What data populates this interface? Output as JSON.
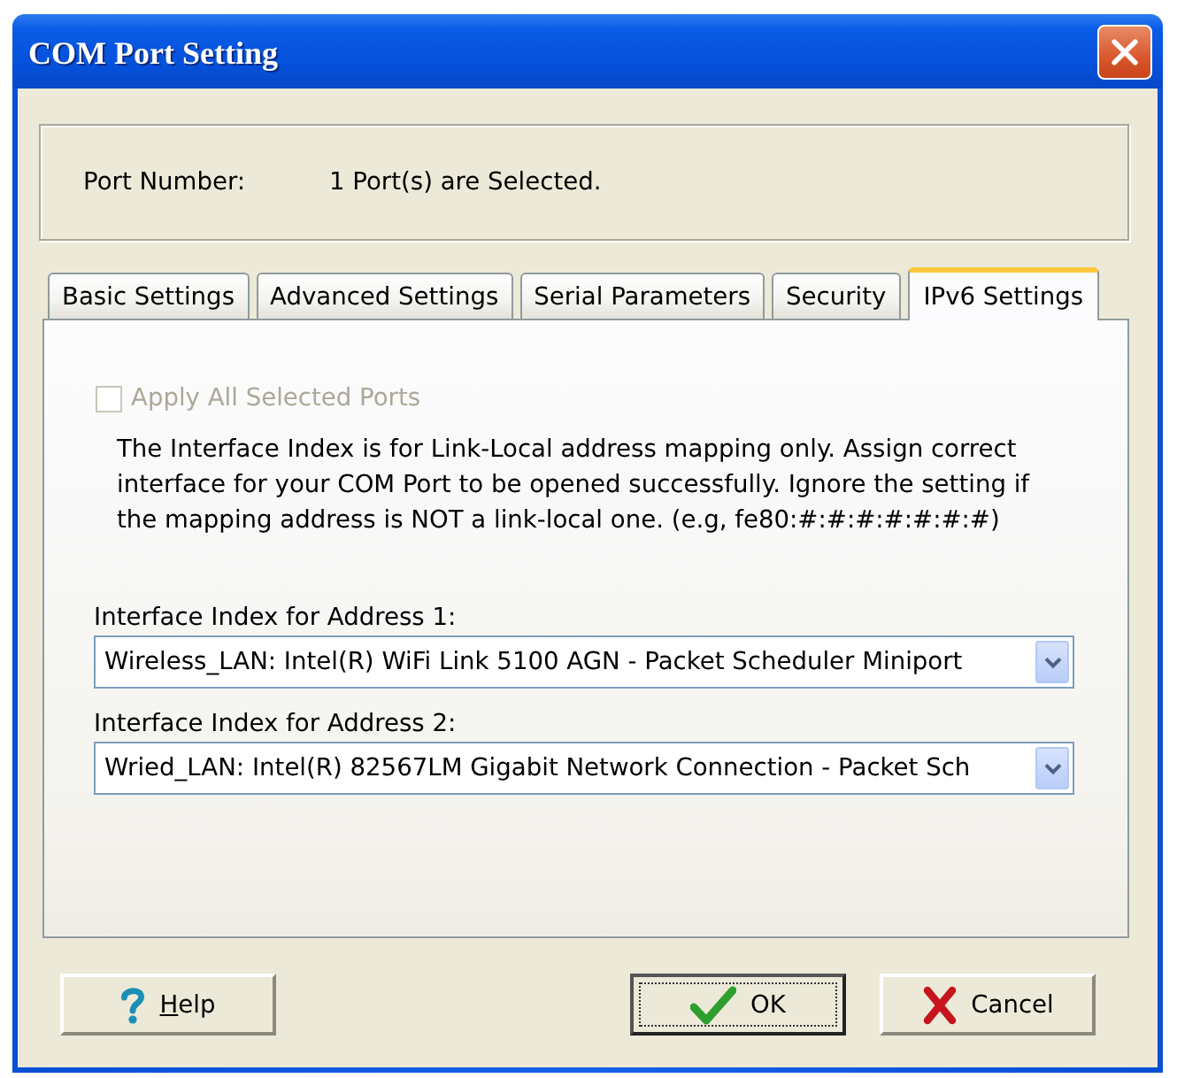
{
  "window": {
    "title": "COM Port Setting"
  },
  "port_number": {
    "label": "Port Number:",
    "value": "1 Port(s) are Selected."
  },
  "tabs": [
    {
      "label": "Basic Settings",
      "selected": false
    },
    {
      "label": "Advanced Settings",
      "selected": false
    },
    {
      "label": "Serial Parameters",
      "selected": false
    },
    {
      "label": "Security",
      "selected": false
    },
    {
      "label": "IPv6 Settings",
      "selected": true
    }
  ],
  "ipv6": {
    "apply_all": {
      "label": "Apply All Selected Ports",
      "checked": false,
      "disabled": true
    },
    "info": "The Interface Index is for Link-Local address mapping only. Assign correct interface for your COM Port to be opened successfully. Ignore the setting if the mapping address is NOT a link-local one. (e.g, fe80:#:#:#:#:#:#:#)",
    "interfaces": [
      {
        "label": "Interface Index for Address 1:",
        "value": "Wireless_LAN: Intel(R) WiFi Link 5100 AGN - Packet Scheduler Miniport"
      },
      {
        "label": "Interface Index for Address 2:",
        "value": "Wried_LAN: Intel(R) 82567LM Gigabit Network Connection - Packet Sch"
      }
    ]
  },
  "buttons": [
    {
      "kind": "help",
      "label": "Help",
      "default": false,
      "access_key_underlined": true
    },
    {
      "kind": "ok",
      "label": "OK",
      "default": true,
      "access_key_underlined": false
    },
    {
      "kind": "cancel",
      "label": "Cancel",
      "default": false,
      "access_key_underlined": false
    }
  ]
}
